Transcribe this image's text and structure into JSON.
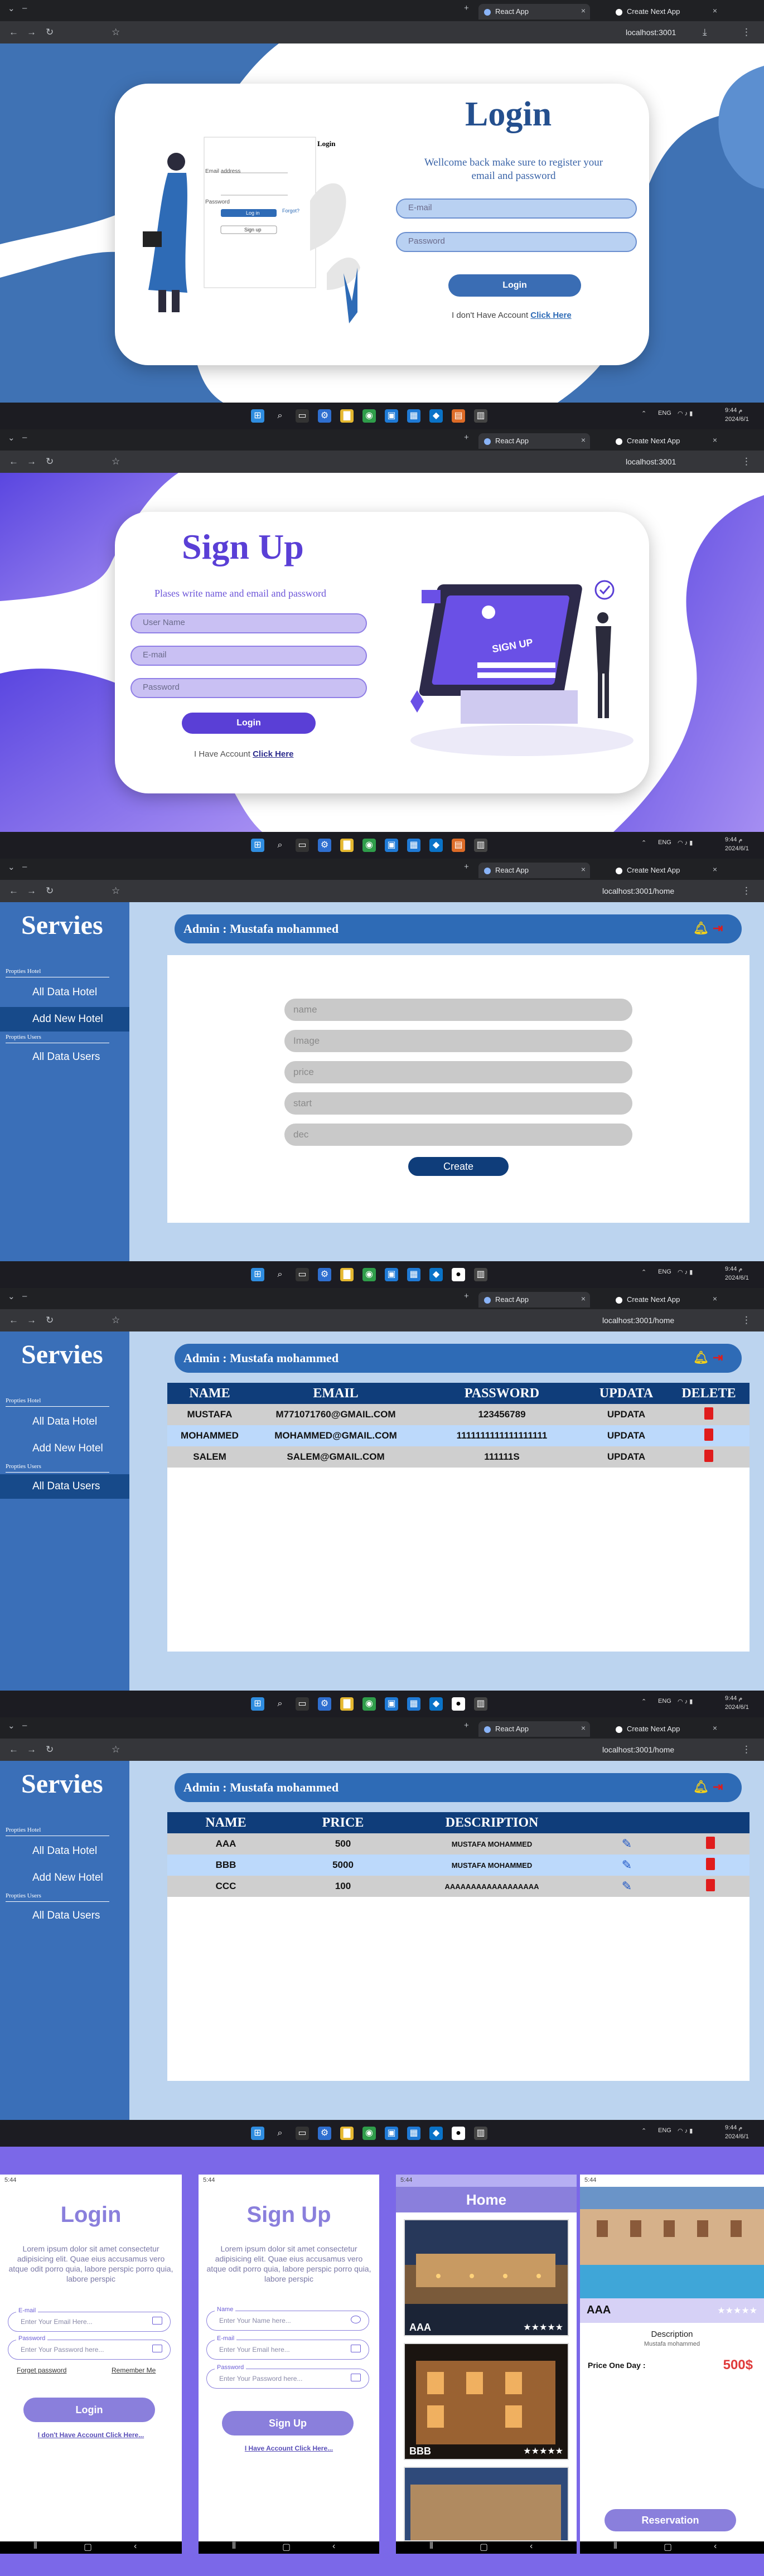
{
  "colors": {
    "accent": "#3f72b4",
    "purple": "#6a50e6",
    "admin_side": "#3a6fb8",
    "table_head": "#0f3d7a"
  },
  "browser1": {
    "tabs": [
      "React App",
      "Create Next App"
    ],
    "url": "localhost:3001"
  },
  "login_page": {
    "title": "Login",
    "subtitle": "Wellcome back make sure to register your email and password",
    "email_placeholder": "E-mail",
    "password_placeholder": "Password",
    "button": "Login",
    "footer_text": "I don't Have Account",
    "footer_link": "Click Here",
    "illustration": {
      "brand": "Login",
      "email_label": "Email address",
      "password_label": "Password",
      "forgot": "Forgot?",
      "login_btn": "Log in",
      "signup_btn": "Sign up"
    }
  },
  "browser2": {
    "tabs": [
      "React App",
      "Create Next App"
    ],
    "url": "localhost:3001"
  },
  "signup_page": {
    "title": "Sign Up",
    "subtitle": "Plases write name and email and password",
    "name_placeholder": "User Name",
    "email_placeholder": "E-mail",
    "password_placeholder": "Password",
    "button": "Login",
    "footer_text": "I Have Account",
    "footer_link": "Click Here",
    "illustration_title": "SIGN UP"
  },
  "browser3": {
    "tabs": [
      "React App",
      "Create Next App"
    ],
    "url": "localhost:3001/home"
  },
  "admin_sidebar": {
    "brand": "Servies",
    "section_hotel": "Propties Hotel",
    "item_all_hotel": "All Data Hotel",
    "item_add_hotel": "Add New Hotel",
    "section_users": "Propties Users",
    "item_all_users": "All Data Users"
  },
  "admin_header": {
    "title": "Admin : Mustafa mohammed"
  },
  "add_hotel_form": {
    "fields": [
      "name",
      "Image",
      "price",
      "start",
      "dec"
    ],
    "button": "Create"
  },
  "browser4": {
    "tabs": [
      "React App",
      "Create Next App"
    ],
    "url": "localhost:3001/home"
  },
  "users_table": {
    "headers": [
      "NAME",
      "EMAIL",
      "PASSWORD",
      "UPDATA",
      "DELETE"
    ],
    "rows": [
      {
        "name": "MUSTAFA",
        "email": "M771071760@GMAIL.COM",
        "password": "123456789",
        "update": "UPDATA"
      },
      {
        "name": "MOHAMMED",
        "email": "MOHAMMED@GMAIL.COM",
        "password": "1111111111111111111",
        "update": "UPDATA"
      },
      {
        "name": "SALEM",
        "email": "SALEM@GMAIL.COM",
        "password": "111111S",
        "update": "UPDATA"
      }
    ]
  },
  "browser5": {
    "tabs": [
      "React App",
      "Create Next App"
    ],
    "url": "localhost:3001/home"
  },
  "hotels_table": {
    "headers": [
      "NAME",
      "PRICE",
      "DESCRIPTION"
    ],
    "rows": [
      {
        "name": "AAA",
        "price": "500",
        "description": "MUSTAFA MOHAMMED"
      },
      {
        "name": "BBB",
        "price": "5000",
        "description": "MUSTAFA MOHAMMED"
      },
      {
        "name": "CCC",
        "price": "100",
        "description": "AAAAAAAAAAAAAAAAAA"
      }
    ]
  },
  "taskbar": {
    "lang": "ENG",
    "time": "9:44 م",
    "date": "2024/6/1"
  },
  "mobile": {
    "status_time": "5:44",
    "login": {
      "title": "Login",
      "body": "Lorem ipsum dolor sit amet consectetur adipisicing elit. Quae eius accusamus vero atque odit porro quia, labore perspic porro quia, labore perspic",
      "email_label": "E-mail",
      "email_placeholder": "Enter Your Email Here...",
      "password_label": "Password",
      "password_placeholder": "Enter Your Password here...",
      "forget": "Forget password",
      "remember": "Remember Me",
      "button": "Login",
      "footer": "I don't Have Account Click Here..."
    },
    "signup": {
      "title": "Sign Up",
      "body": "Lorem ipsum dolor sit amet consectetur adipisicing elit. Quae eius accusamus vero atque odit porro quia, labore perspic porro quia, labore perspic",
      "name_label": "Name",
      "name_placeholder": "Enter Your Name here...",
      "email_label": "E-mail",
      "email_placeholder": "Enter Your Email here...",
      "password_label": "Password",
      "password_placeholder": "Enter Your Password here...",
      "button": "Sign Up",
      "footer": "I Have Account Click Here..."
    },
    "home": {
      "title": "Home",
      "cards": [
        {
          "name": "AAA",
          "stars": "★★★★★"
        },
        {
          "name": "BBB",
          "stars": "★★★★★"
        }
      ]
    },
    "detail": {
      "name": "AAA",
      "stars": "★★★★★",
      "desc_label": "Description",
      "desc_value": "Mustafa mohammed",
      "price_label": "Price One Day :",
      "price_value": "500$",
      "button": "Reservation"
    }
  }
}
